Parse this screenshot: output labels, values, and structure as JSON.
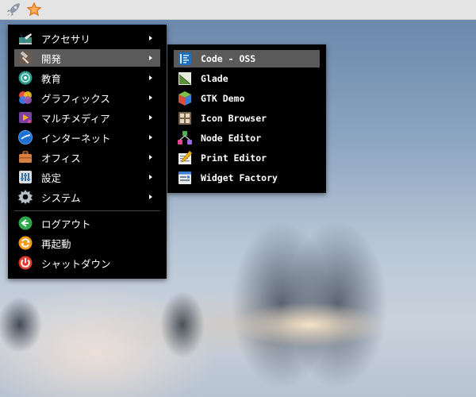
{
  "desktop": {
    "panel": {
      "launcher_icon": "rocket-icon",
      "favorite_icon": "star-icon"
    }
  },
  "main_menu": {
    "items": [
      {
        "label": "アクセサリ",
        "icon": "accessories-icon",
        "has_submenu": true
      },
      {
        "label": "開発",
        "icon": "development-hammer-icon",
        "has_submenu": true,
        "active": true
      },
      {
        "label": "教育",
        "icon": "education-icon",
        "has_submenu": true
      },
      {
        "label": "グラフィックス",
        "icon": "graphics-icon",
        "has_submenu": true
      },
      {
        "label": "マルチメディア",
        "icon": "multimedia-icon",
        "has_submenu": true
      },
      {
        "label": "インターネット",
        "icon": "internet-icon",
        "has_submenu": true
      },
      {
        "label": "オフィス",
        "icon": "office-briefcase-icon",
        "has_submenu": true
      },
      {
        "label": "設定",
        "icon": "settings-icon",
        "has_submenu": true
      },
      {
        "label": "システム",
        "icon": "system-gear-icon",
        "has_submenu": true
      }
    ],
    "session_items": [
      {
        "label": "ログアウト",
        "icon": "logout-icon"
      },
      {
        "label": "再起動",
        "icon": "reboot-icon"
      },
      {
        "label": "シャットダウン",
        "icon": "shutdown-icon"
      }
    ]
  },
  "dev_submenu": {
    "items": [
      {
        "label": "Code - OSS",
        "icon": "code-oss-icon",
        "active": true
      },
      {
        "label": "Glade",
        "icon": "glade-icon"
      },
      {
        "label": "GTK Demo",
        "icon": "gtk-demo-icon"
      },
      {
        "label": "Icon Browser",
        "icon": "icon-browser-icon"
      },
      {
        "label": "Node Editor",
        "icon": "node-editor-icon"
      },
      {
        "label": "Print Editor",
        "icon": "print-editor-icon"
      },
      {
        "label": "Widget Factory",
        "icon": "widget-factory-icon"
      }
    ]
  },
  "colors": {
    "menu_bg": "#000000",
    "highlight": "#5a5a5a",
    "panel_bg": "#e4e4e4"
  }
}
